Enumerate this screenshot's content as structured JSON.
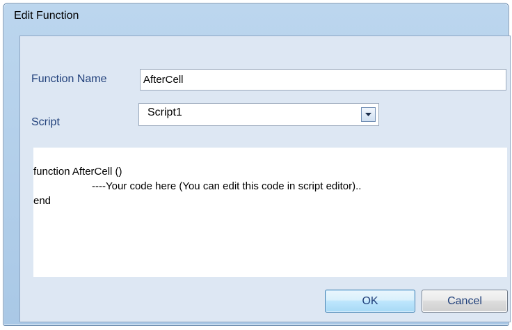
{
  "window": {
    "title": "Edit Function"
  },
  "form": {
    "function_name_label": "Function Name",
    "function_name_value": "AfterCell",
    "script_label": "Script",
    "script_selected": "Script1",
    "dropdown_icon": "chevron-down-icon"
  },
  "code": {
    "lines": [
      "function AfterCell ()",
      "----Your code here (You can edit this code in script editor)..",
      "end"
    ]
  },
  "buttons": {
    "ok_label": "OK",
    "cancel_label": "Cancel"
  },
  "colors": {
    "label_text": "#1f3f7a",
    "frame": "#a9c8e6",
    "client_bg": "#dde7f3",
    "ok_border": "#3c7fb1"
  }
}
